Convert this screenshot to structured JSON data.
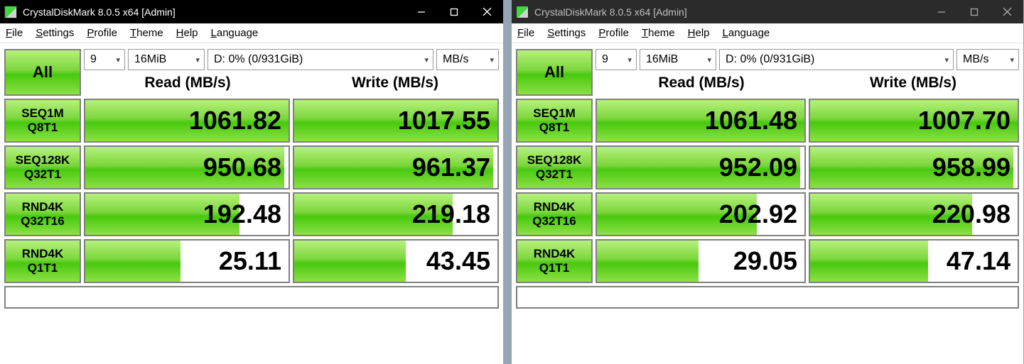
{
  "windows": [
    {
      "title": "CrystalDiskMark 8.0.5 x64 [Admin]",
      "active": true,
      "menu": [
        "File",
        "Settings",
        "Profile",
        "Theme",
        "Help",
        "Language"
      ],
      "all_label": "All",
      "selects": {
        "count": "9",
        "size": "16MiB",
        "drive": "D: 0% (0/931GiB)",
        "unit": "MB/s"
      },
      "headers": {
        "read": "Read (MB/s)",
        "write": "Write (MB/s)"
      },
      "tests": [
        {
          "label1": "SEQ1M",
          "label2": "Q8T1",
          "read": "1061.82",
          "write": "1017.55",
          "read_fill": 100,
          "write_fill": 100
        },
        {
          "label1": "SEQ128K",
          "label2": "Q32T1",
          "read": "950.68",
          "write": "961.37",
          "read_fill": 98,
          "write_fill": 98
        },
        {
          "label1": "RND4K",
          "label2": "Q32T16",
          "read": "192.48",
          "write": "219.18",
          "read_fill": 76,
          "write_fill": 78
        },
        {
          "label1": "RND4K",
          "label2": "Q1T1",
          "read": "25.11",
          "write": "43.45",
          "read_fill": 47,
          "write_fill": 55
        }
      ]
    },
    {
      "title": "CrystalDiskMark 8.0.5 x64 [Admin]",
      "active": false,
      "menu": [
        "File",
        "Settings",
        "Profile",
        "Theme",
        "Help",
        "Language"
      ],
      "all_label": "All",
      "selects": {
        "count": "9",
        "size": "16MiB",
        "drive": "D: 0% (0/931GiB)",
        "unit": "MB/s"
      },
      "headers": {
        "read": "Read (MB/s)",
        "write": "Write (MB/s)"
      },
      "tests": [
        {
          "label1": "SEQ1M",
          "label2": "Q8T1",
          "read": "1061.48",
          "write": "1007.70",
          "read_fill": 100,
          "write_fill": 100
        },
        {
          "label1": "SEQ128K",
          "label2": "Q32T1",
          "read": "952.09",
          "write": "958.99",
          "read_fill": 98,
          "write_fill": 98
        },
        {
          "label1": "RND4K",
          "label2": "Q32T16",
          "read": "202.92",
          "write": "220.98",
          "read_fill": 77,
          "write_fill": 78
        },
        {
          "label1": "RND4K",
          "label2": "Q1T1",
          "read": "29.05",
          "write": "47.14",
          "read_fill": 49,
          "write_fill": 57
        }
      ]
    }
  ]
}
